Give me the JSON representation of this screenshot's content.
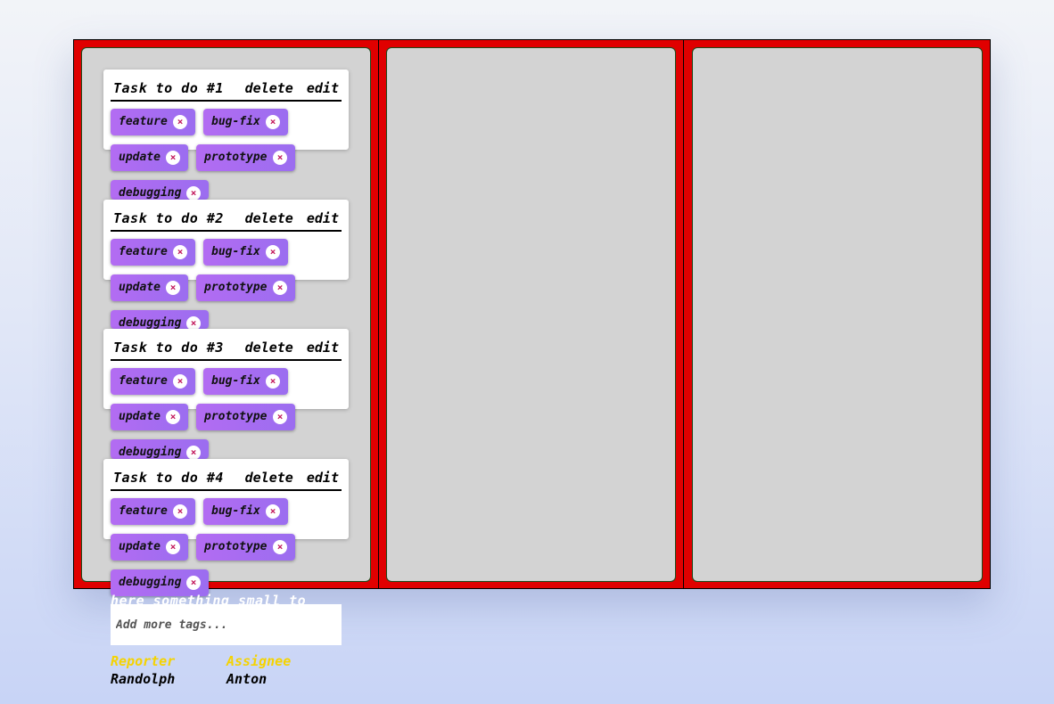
{
  "columns": [
    {
      "id": "col-1"
    },
    {
      "id": "col-2"
    },
    {
      "id": "col-3"
    }
  ],
  "cards": [
    {
      "title": "Task to do #1",
      "delete": "delete",
      "edit": "edit"
    },
    {
      "title": "Task to do #2",
      "delete": "delete",
      "edit": "edit"
    },
    {
      "title": "Task to do #3",
      "delete": "delete",
      "edit": "edit"
    },
    {
      "title": "Task to do #4",
      "delete": "delete",
      "edit": "edit"
    }
  ],
  "tags": [
    "feature",
    "bug-fix",
    "update",
    "prototype",
    "debugging"
  ],
  "tag_remove_glyph": "×",
  "description": "here something small to write",
  "tag_input": {
    "placeholder": "Add more tags..."
  },
  "reporter": {
    "label": "Reporter",
    "name": "Randolph"
  },
  "assignee": {
    "label": "Assignee",
    "name": "Anton"
  },
  "colors": {
    "board": "#e00000",
    "column": "#d3d3d3",
    "tag": "#a36cf0",
    "role": "#f5d300"
  }
}
